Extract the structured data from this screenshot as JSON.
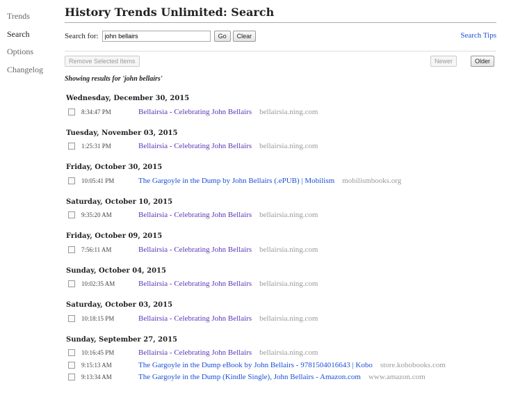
{
  "nav": {
    "items": [
      "Trends",
      "Search",
      "Options",
      "Changelog"
    ],
    "active": "Search"
  },
  "page": {
    "title": "History Trends Unlimited: Search"
  },
  "search": {
    "label": "Search for:",
    "value": "john bellairs",
    "go_label": "Go",
    "clear_label": "Clear",
    "tips_label": "Search Tips"
  },
  "toolbar": {
    "remove_label": "Remove Selected Items",
    "newer_label": "Newer",
    "older_label": "Older"
  },
  "results": {
    "showing": "Showing results for 'john bellairs'",
    "days": [
      {
        "date": "Wednesday, December 30, 2015",
        "items": [
          {
            "time": "8:34:47 PM",
            "title": "Bellairsia - Celebrating John Bellairs",
            "domain": "bellairsia.ning.com",
            "visited": true
          }
        ]
      },
      {
        "date": "Tuesday, November 03, 2015",
        "items": [
          {
            "time": "1:25:31 PM",
            "title": "Bellairsia - Celebrating John Bellairs",
            "domain": "bellairsia.ning.com",
            "visited": true
          }
        ]
      },
      {
        "date": "Friday, October 30, 2015",
        "items": [
          {
            "time": "10:05:41 PM",
            "title": "The Gargoyle in the Dump by John Bellairs (.ePUB) | Mobilism",
            "domain": "mobilismbooks.org",
            "visited": false
          }
        ]
      },
      {
        "date": "Saturday, October 10, 2015",
        "items": [
          {
            "time": "9:35:20 AM",
            "title": "Bellairsia - Celebrating John Bellairs",
            "domain": "bellairsia.ning.com",
            "visited": true
          }
        ]
      },
      {
        "date": "Friday, October 09, 2015",
        "items": [
          {
            "time": "7:56:11 AM",
            "title": "Bellairsia - Celebrating John Bellairs",
            "domain": "bellairsia.ning.com",
            "visited": true
          }
        ]
      },
      {
        "date": "Sunday, October 04, 2015",
        "items": [
          {
            "time": "10:02:35 AM",
            "title": "Bellairsia - Celebrating John Bellairs",
            "domain": "bellairsia.ning.com",
            "visited": true
          }
        ]
      },
      {
        "date": "Saturday, October 03, 2015",
        "items": [
          {
            "time": "10:18:15 PM",
            "title": "Bellairsia - Celebrating John Bellairs",
            "domain": "bellairsia.ning.com",
            "visited": true
          }
        ]
      },
      {
        "date": "Sunday, September 27, 2015",
        "items": [
          {
            "time": "10:16:45 PM",
            "title": "Bellairsia - Celebrating John Bellairs",
            "domain": "bellairsia.ning.com",
            "visited": true
          },
          {
            "time": "9:15:13 AM",
            "title": "The Gargoyle in the Dump eBook by John Bellairs - 9781504016643 | Kobo",
            "domain": "store.kobobooks.com",
            "visited": false
          },
          {
            "time": "9:13:34 AM",
            "title": "The Gargoyle in the Dump (Kindle Single), John Bellairs - Amazon.com",
            "domain": "www.amazon.com",
            "visited": false
          }
        ]
      }
    ]
  },
  "colors": {
    "visited_link": "#5a35b8",
    "unvisited_link": "#1a4fd6",
    "domain_text": "#999999"
  }
}
